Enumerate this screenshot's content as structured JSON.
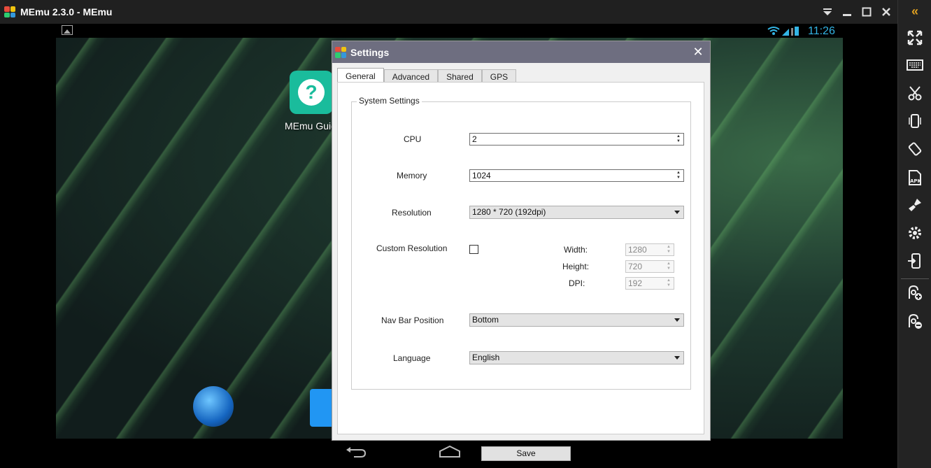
{
  "window": {
    "title": "MEmu 2.3.0 - MEmu"
  },
  "statusbar": {
    "time": "11:26"
  },
  "desktop": {
    "icons": [
      {
        "label": "MEmu Guid"
      }
    ]
  },
  "dialog": {
    "title": "Settings",
    "tabs": [
      {
        "label": "General",
        "active": true
      },
      {
        "label": "Advanced",
        "active": false
      },
      {
        "label": "Shared",
        "active": false
      },
      {
        "label": "GPS",
        "active": false
      }
    ],
    "group_title": "System Settings",
    "cpu": {
      "label": "CPU",
      "value": "2"
    },
    "memory": {
      "label": "Memory",
      "value": "1024"
    },
    "resolution": {
      "label": "Resolution",
      "value": "1280 * 720 (192dpi)"
    },
    "custom_resolution": {
      "label": "Custom Resolution",
      "checked": false,
      "width": {
        "label": "Width:",
        "value": "1280"
      },
      "height": {
        "label": "Height:",
        "value": "720"
      },
      "dpi": {
        "label": "DPI:",
        "value": "192"
      }
    },
    "nav_bar": {
      "label": "Nav Bar Position",
      "value": "Bottom"
    },
    "language": {
      "label": "Language",
      "value": "English"
    },
    "save_label": "Save"
  },
  "colors": {
    "accent_clock": "#33b5e5",
    "dialog_title_bar": "#6e6e80",
    "collapse_arrow": "#e0a020"
  }
}
